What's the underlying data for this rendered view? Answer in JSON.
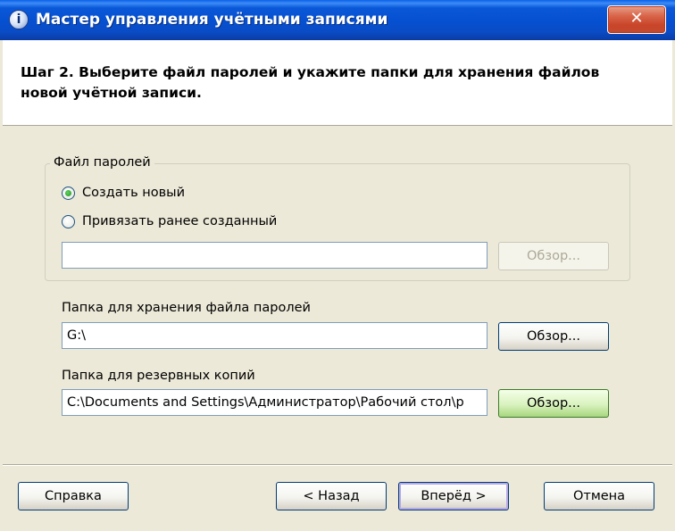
{
  "window": {
    "title": "Мастер управления учётными записями",
    "close_glyph": "✕",
    "title_icon": "info-icon"
  },
  "header": {
    "step_text": "Шаг 2. Выберите файл паролей и укажите папки для хранения файлов новой учётной записи."
  },
  "password_file_group": {
    "label": "Файл паролей",
    "options": [
      {
        "label": "Создать новый",
        "checked": true
      },
      {
        "label": "Привязать ранее созданный",
        "checked": false
      }
    ],
    "path_value": "",
    "browse_label": "Обзор..."
  },
  "storage_folder": {
    "label": "Папка для хранения файла паролей",
    "value": "G:\\",
    "browse_label": "Обзор..."
  },
  "backup_folder": {
    "label": "Папка для резервных копий",
    "value": "C:\\Documents and Settings\\Администратор\\Рабочий стол\\р",
    "browse_label": "Обзор..."
  },
  "footer": {
    "help_label": "Справка",
    "back_label": "< Назад",
    "next_label": "Вперёд >",
    "cancel_label": "Отмена"
  }
}
